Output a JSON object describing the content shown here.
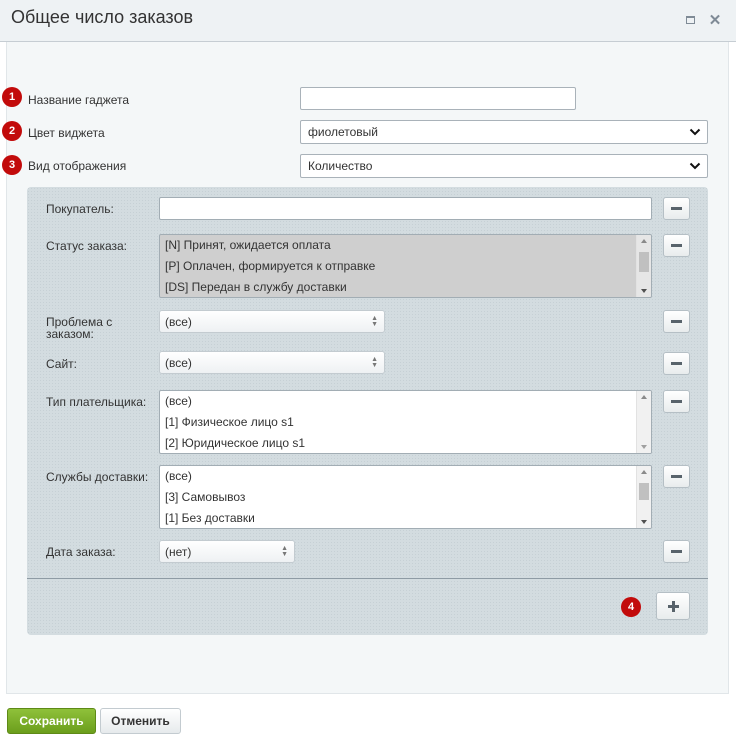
{
  "dialog": {
    "title": "Общее число заказов"
  },
  "settings": {
    "name_label": "Название гаджета",
    "name_value": "",
    "color_label": "Цвет виджета",
    "color_value": "фиолетовый",
    "view_label": "Вид отображения",
    "view_value": "Количество"
  },
  "badges": [
    "1",
    "2",
    "3",
    "4"
  ],
  "filters": {
    "buyer_label": "Покупатель:",
    "buyer_value": "",
    "status_label": "Статус заказа:",
    "status_options": [
      "[N] Принят, ожидается оплата",
      "[P] Оплачен, формируется к отправке",
      "[DS] Передан в службу доставки"
    ],
    "problem_label": "Проблема с заказом:",
    "problem_value": "(все)",
    "site_label": "Сайт:",
    "site_value": "(все)",
    "payer_label": "Тип плательщика:",
    "payer_options": [
      "(все)",
      "[1] Физическое лицо s1",
      "[2] Юридическое лицо s1"
    ],
    "delivery_label": "Службы доставки:",
    "delivery_options": [
      "(все)",
      "[3] Самовывоз",
      "[1] Без доставки"
    ],
    "date_label": "Дата заказа:",
    "date_value": "(нет)"
  },
  "footer": {
    "save_label": "Сохранить",
    "cancel_label": "Отменить"
  },
  "colors": {
    "accent_green": "#7cb02c",
    "badge_red": "#c20b0b",
    "panel": "#d3dce0"
  }
}
